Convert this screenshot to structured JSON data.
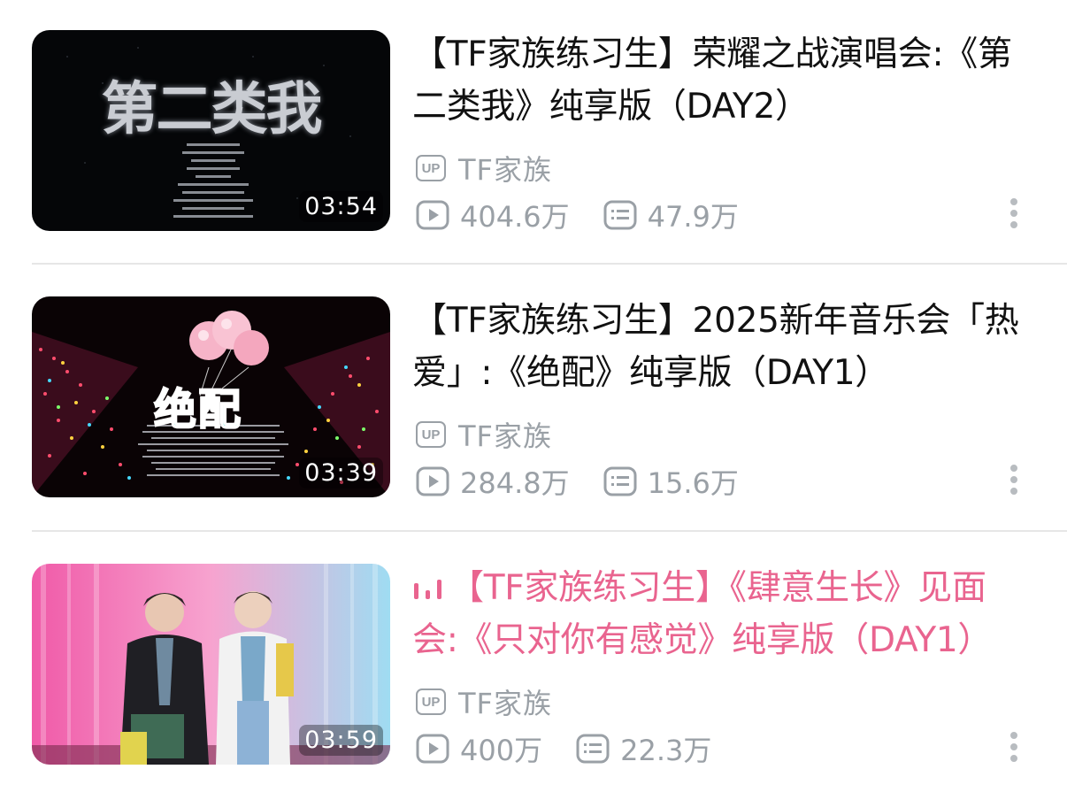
{
  "videos": [
    {
      "title_line1": "【TF家族练习生】荣耀之战演唱会:《第",
      "title_line2": "二类我》纯享版（DAY2）",
      "thumbnail_text": "第二类我",
      "duration": "03:54",
      "up_badge": "UP",
      "uploader": "TF家族",
      "views": "404.6万",
      "comments": "47.9万",
      "playing": false
    },
    {
      "title_line1": "【TF家族练习生】2025新年音乐会「热",
      "title_line2": "爱」:《绝配》纯享版（DAY1）",
      "thumbnail_text": "绝配",
      "duration": "03:39",
      "up_badge": "UP",
      "uploader": "TF家族",
      "views": "284.8万",
      "comments": "15.6万",
      "playing": false
    },
    {
      "title_line1": "【TF家族练习生】《肆意生长》见面",
      "title_line2": "会:《只对你有感觉》纯享版（DAY1）",
      "thumbnail_text": "",
      "duration": "03:59",
      "up_badge": "UP",
      "uploader": "TF家族",
      "views": "400万",
      "comments": "22.3万",
      "playing": true
    }
  ],
  "colors": {
    "playing_title": "#e9648f",
    "meta_gray": "#9aa0a6",
    "divider": "#e6e6e6"
  },
  "icons": {
    "up_badge": "up-badge-icon",
    "views": "play-icon",
    "comments": "danmaku-icon",
    "more": "more-vertical-icon",
    "playing": "playing-bars-icon"
  }
}
